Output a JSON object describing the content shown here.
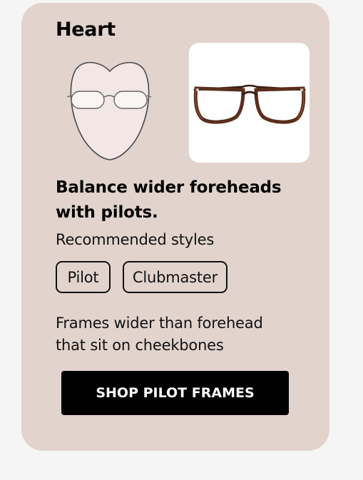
{
  "card": {
    "shape_title": "Heart",
    "headline": "Balance wider foreheads with pilots.",
    "subheading": "Recommended styles",
    "styles": [
      {
        "label": "Pilot"
      },
      {
        "label": "Clubmaster"
      }
    ],
    "description": "Frames wider than forehead that sit on cheekbones",
    "cta_label": "SHOP PILOT FRAMES"
  },
  "icons": {
    "face": "heart-face-shape-illustration",
    "product": "tortoiseshell-pilot-glasses-image"
  },
  "colors": {
    "card_background": "#e2d3cd",
    "page_background": "#f5f5f5",
    "cta_background": "#000000",
    "cta_text": "#ffffff",
    "frame_tortoise": "#5a2e1c"
  }
}
